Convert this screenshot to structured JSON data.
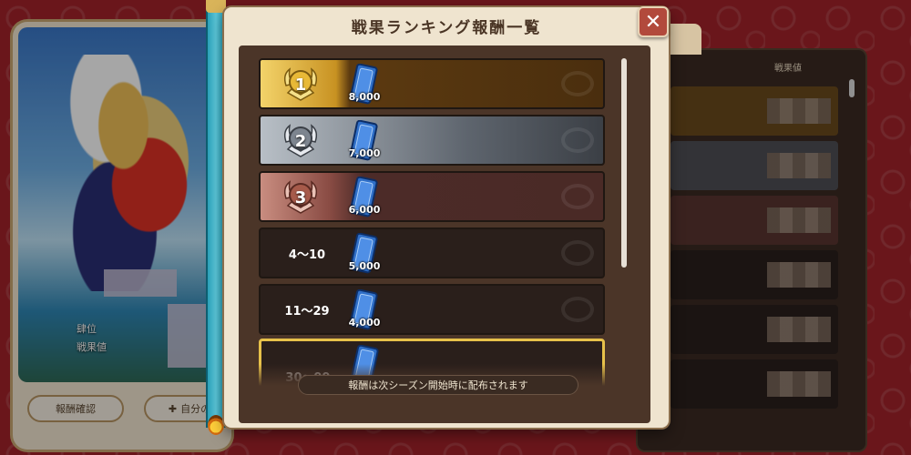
{
  "dialog": {
    "title": "戦果ランキング報酬一覧",
    "close_label": "✕",
    "notice": "報酬は次シーズン開始時に配布されます"
  },
  "rewards": [
    {
      "rank": "1",
      "tier": "gold",
      "amount": "8,000"
    },
    {
      "rank": "2",
      "tier": "silver",
      "amount": "7,000"
    },
    {
      "rank": "3",
      "tier": "bronze",
      "amount": "6,000"
    },
    {
      "rank": "4〜10",
      "tier": "plain",
      "amount": "5,000"
    },
    {
      "rank": "11〜29",
      "tier": "plain",
      "amount": "4,000"
    },
    {
      "rank": "30〜99",
      "tier": "highlight",
      "amount": ""
    }
  ],
  "hero_card": {
    "info_line1": "肆位",
    "info_line2": "戦果値",
    "button_left": "報酬確認",
    "button_right": "自分の"
  },
  "background_panel": {
    "header": "戦果値"
  },
  "colors": {
    "background": "#a3232a",
    "dialog": "#efe4cf",
    "list": "#4b3528",
    "gold": "#d9a82a",
    "highlight_border": "#e7c14a",
    "ticket": "#2f6fc8",
    "close_button": "#b24a3c"
  },
  "icons": {
    "close": "close-icon",
    "ticket": "ticket-icon",
    "medal": "laurel-medal-icon"
  }
}
